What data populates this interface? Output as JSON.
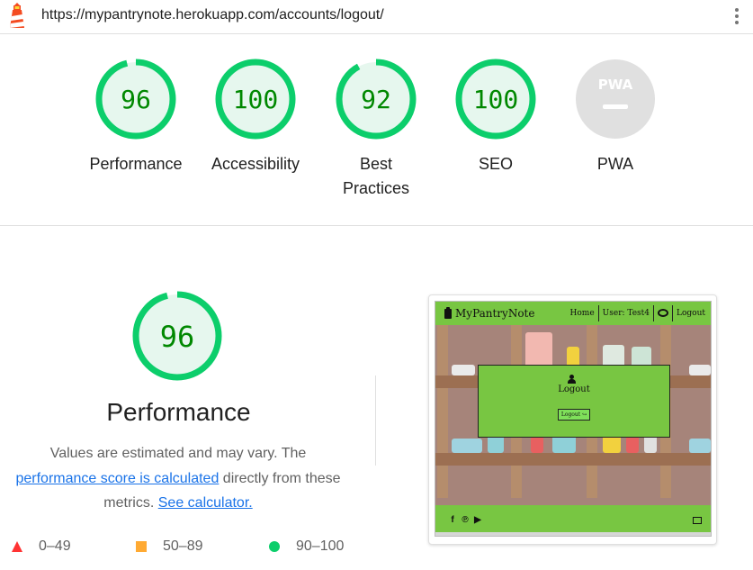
{
  "url_bar": {
    "url": "https://mypantrynote.herokuapp.com/accounts/logout/",
    "logo_icon": "lighthouse-icon",
    "menu_icon": "kebab-menu-icon"
  },
  "gauges": [
    {
      "label": "Performance",
      "score": "96",
      "fraction": 0.96,
      "color": "#0cce6b",
      "text_color": "#008800"
    },
    {
      "label": "Accessibility",
      "score": "100",
      "fraction": 1.0,
      "color": "#0cce6b",
      "text_color": "#008800"
    },
    {
      "label_line1": "Best",
      "label_line2": "Practices",
      "score": "92",
      "fraction": 0.92,
      "color": "#0cce6b",
      "text_color": "#008800"
    },
    {
      "label": "SEO",
      "score": "100",
      "fraction": 1.0,
      "color": "#0cce6b",
      "text_color": "#008800"
    },
    {
      "label": "PWA",
      "badge_text": "PWA",
      "color": "#e0e0e0"
    }
  ],
  "performance": {
    "score": "96",
    "fraction": 0.96,
    "title": "Performance",
    "desc_1": "Values are estimated and may vary. The",
    "link_1": "performance score is calculated",
    "desc_2": " directly from these metrics. ",
    "link_2": "See calculator."
  },
  "legend": [
    {
      "shape": "triangle",
      "range": "0–49",
      "color": "#ff3333"
    },
    {
      "shape": "square",
      "range": "50–89",
      "color": "#ffaa33"
    },
    {
      "shape": "circle",
      "range": "90–100",
      "color": "#0cce6b"
    }
  ],
  "screenshot": {
    "brand": "MyPantryNote",
    "nav": [
      "Home",
      "User: Test4",
      "Logout"
    ],
    "modal_title": "Logout",
    "modal_button": "Logout",
    "accent": "#78c642",
    "social_icons": [
      "facebook-icon",
      "pinterest-icon",
      "youtube-icon"
    ],
    "contact_icon": "envelope-icon"
  }
}
